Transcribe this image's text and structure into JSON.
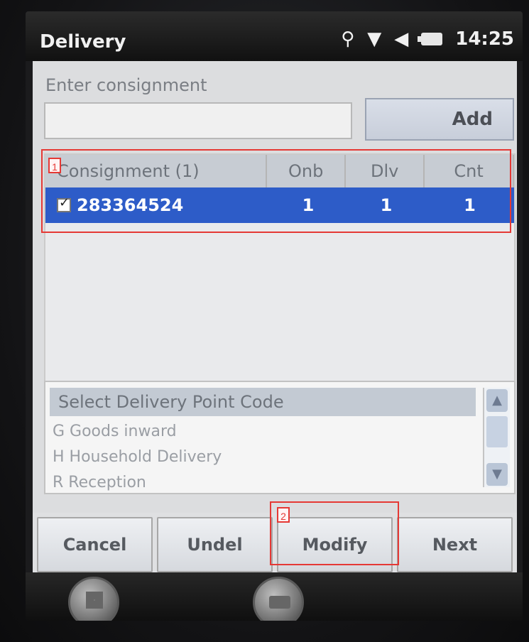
{
  "window": {
    "title": "Delivery",
    "time": "14:25"
  },
  "form": {
    "label": "Enter consignment",
    "input_value": "",
    "add_label": "Add"
  },
  "grid": {
    "columns": [
      "Consignment (1)",
      "Onb",
      "Dlv",
      "Cnt"
    ],
    "rows": [
      {
        "checked": true,
        "consignment": "283364524",
        "onb": "1",
        "dlv": "1",
        "cnt": "1"
      }
    ]
  },
  "delivery_point": {
    "header": "Select Delivery Point Code",
    "items": [
      "G Goods inward",
      "H Household Delivery",
      "R Reception"
    ]
  },
  "buttons": {
    "cancel": "Cancel",
    "undel": "Undel",
    "modify": "Modify",
    "next": "Next"
  },
  "icons": {
    "status": [
      "antenna-icon",
      "signal-icon",
      "volume-icon",
      "battery-icon"
    ],
    "taskbar": [
      "start-icon",
      "keyboard-icon"
    ]
  },
  "annotations": {
    "one": "1",
    "two": "2"
  },
  "colors": {
    "selection": "#2d5cc8",
    "annotation": "#e53935"
  }
}
